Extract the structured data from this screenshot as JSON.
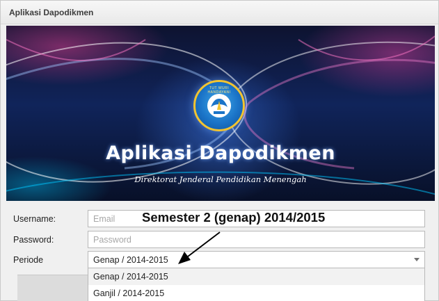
{
  "window": {
    "title": "Aplikasi Dapodikmen"
  },
  "banner": {
    "title": "Aplikasi Dapodikmen",
    "subtitle": "Direktorat Jenderal Pendidikan Menengah",
    "logo_text": "TUT WURI HANDAYANI"
  },
  "form": {
    "username": {
      "label": "Username:",
      "placeholder": "Email",
      "value": ""
    },
    "password": {
      "label": "Password:",
      "placeholder": "Password",
      "value": ""
    },
    "periode": {
      "label": "Periode",
      "selected": "Genap / 2014-2015",
      "options": [
        "Genap / 2014-2015",
        "Ganjil / 2014-2015"
      ]
    }
  },
  "annotation": {
    "text": "Semester 2 (genap) 2014/2015"
  },
  "colors": {
    "accent_blue": "#1b74c8",
    "logo_gold": "#f2c431"
  }
}
